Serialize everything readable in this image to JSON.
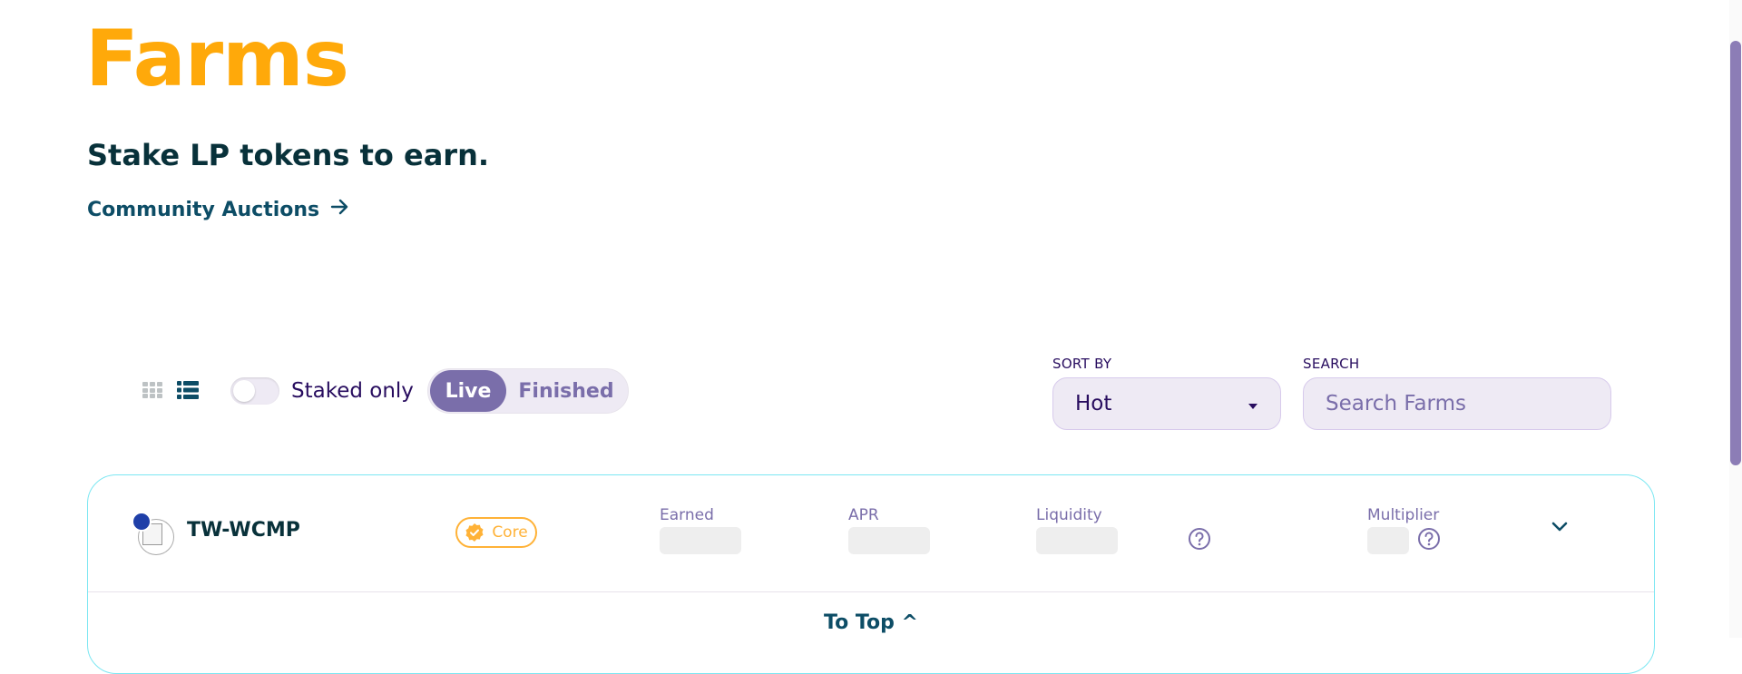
{
  "header": {
    "title": "Farms",
    "subtitle": "Stake LP tokens to earn.",
    "community_link": "Community Auctions"
  },
  "controls": {
    "staked_only_label": "Staked only",
    "staked_only_on": false,
    "tabs": [
      {
        "label": "Live",
        "active": true
      },
      {
        "label": "Finished",
        "active": false
      }
    ],
    "sort_by_label": "SORT BY",
    "sort_value": "Hot",
    "search_label": "SEARCH",
    "search_placeholder": "Search Farms"
  },
  "farm": {
    "name": "TW-WCMP",
    "badge": "Core",
    "columns": {
      "earned": "Earned",
      "apr": "APR",
      "liquidity": "Liquidity",
      "multiplier": "Multiplier"
    }
  },
  "footer": {
    "to_top": "To Top ^"
  },
  "colors": {
    "title": "#ffa90a",
    "accent": "#7a6eaa",
    "badge": "#ffb237",
    "border": "#7ce7f2"
  }
}
